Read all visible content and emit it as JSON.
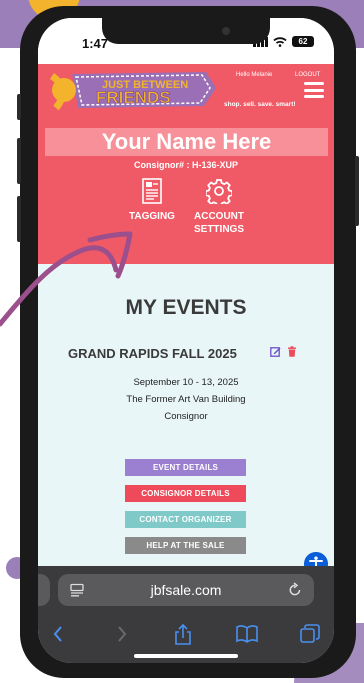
{
  "status_bar": {
    "time": "1:47",
    "battery": "62"
  },
  "header": {
    "logo_text": [
      "JUST BETWEEN",
      "FRIENDS"
    ],
    "greeting": "Hello Melanie",
    "logout": "LOGOUT",
    "tagline": "shop. sell. save. smart!"
  },
  "consignor": {
    "name": "Your Name Here",
    "number": "Consignor# : H-136-XUP",
    "actions": [
      {
        "label_1": "TAGGING",
        "label_2": "",
        "icon": "tag-sheet-icon"
      },
      {
        "label_1": "ACCOUNT",
        "label_2": "SETTINGS",
        "icon": "gear-icon"
      }
    ]
  },
  "events": {
    "title": "MY EVENTS",
    "event_name": "GRAND RAPIDS FALL 2025",
    "dates": "September 10 - 13, 2025",
    "location": "The Former Art Van Building",
    "role": "Consignor",
    "buttons": [
      {
        "label": "EVENT DETAILS",
        "color": "#9b7fd0"
      },
      {
        "label": "CONSIGNOR DETAILS",
        "color": "#ef4a5a"
      },
      {
        "label": "CONTACT ORGANIZER",
        "color": "#7fc9c8"
      },
      {
        "label": "HELP AT THE SALE",
        "color": "#8a8a8a"
      }
    ]
  },
  "browser": {
    "url": "jbfsale.com",
    "nav": [
      "back-icon",
      "forward-icon",
      "share-icon",
      "bookmarks-icon",
      "tabs-icon"
    ]
  },
  "colors": {
    "brand_coral": "#f05a66",
    "brand_purple": "#9b7fb8",
    "page_background": "#e9f6f8",
    "accent_yellow": "#f3b32c",
    "arrow": "#9b4f8c"
  }
}
